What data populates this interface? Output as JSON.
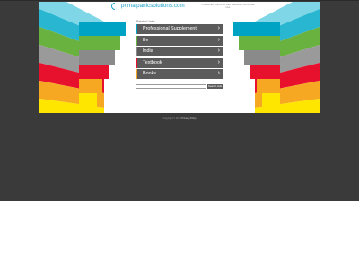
{
  "header": {
    "logo_text": "primalpanicsolutions.com",
    "note": "This domain may be for sale. Backorder this domain now."
  },
  "sidebar_label": "Related Links",
  "links": [
    {
      "label": "Professional Supplement",
      "accent": "#00a3c4"
    },
    {
      "label": "Bv",
      "accent": "#6ab23f"
    },
    {
      "label": "India",
      "accent": "#8a8a8a"
    },
    {
      "label": "Textbook",
      "accent": "#e8112d"
    },
    {
      "label": "Books",
      "accent": "#f7a823"
    }
  ],
  "search": {
    "placeholder": "",
    "button_label": "Search Ads"
  },
  "footer": {
    "copyright": "Copyright © 2024 ",
    "privacy_label": "Privacy Policy"
  },
  "colors": {
    "background": "#3a3a3a",
    "panel": "#ffffff",
    "brand": "#1aa0c8",
    "stripe_palette": [
      "#29b6d1",
      "#6ab23f",
      "#9a9a9a",
      "#e8112d",
      "#f7a823",
      "#ffe600"
    ]
  }
}
